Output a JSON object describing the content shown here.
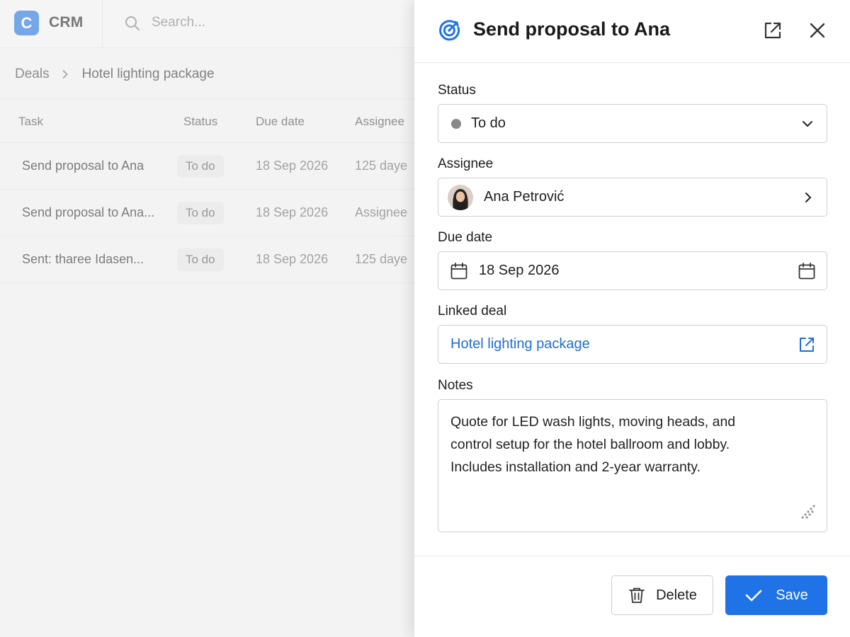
{
  "app": {
    "logo_letter": "C",
    "name": "CRM",
    "search_placeholder": "Search..."
  },
  "breadcrumb": {
    "parent": "Deals",
    "current": "Hotel lighting package"
  },
  "table": {
    "headers": [
      "Task",
      "Status",
      "Due date",
      "Assignee"
    ],
    "rows": [
      {
        "task": "Send proposal to Ana",
        "status": "To do",
        "due": "18 Sep 2026",
        "assignee": "125 daye"
      },
      {
        "task": "Send proposal to Ana...",
        "status": "To do",
        "due": "18 Sep 2026",
        "assignee": "Assignee"
      },
      {
        "task": "Sent: tharee Idasen...",
        "status": "To do",
        "due": "18 Sep 2026",
        "assignee": "125 daye"
      }
    ]
  },
  "panel": {
    "title": "Send proposal to Ana",
    "icon": "target-icon",
    "status": {
      "label": "Status",
      "value": "To do",
      "dot_color": "#888888"
    },
    "assignee": {
      "label": "Assignee",
      "value": "Ana Petrović"
    },
    "due_date": {
      "label": "Due date",
      "value": "18 Sep 2026"
    },
    "linked_deal": {
      "label": "Linked deal",
      "value": "Hotel lighting package",
      "color": "#1f6fd1"
    },
    "notes": {
      "label": "Notes",
      "value": "Quote for LED wash lights, moving heads, and\ncontrol setup for the hotel ballroom and lobby.\nIncludes installation and 2-year warranty."
    },
    "actions": {
      "delete": "Delete",
      "save": "Save",
      "save_color": "#1f73e6"
    }
  }
}
